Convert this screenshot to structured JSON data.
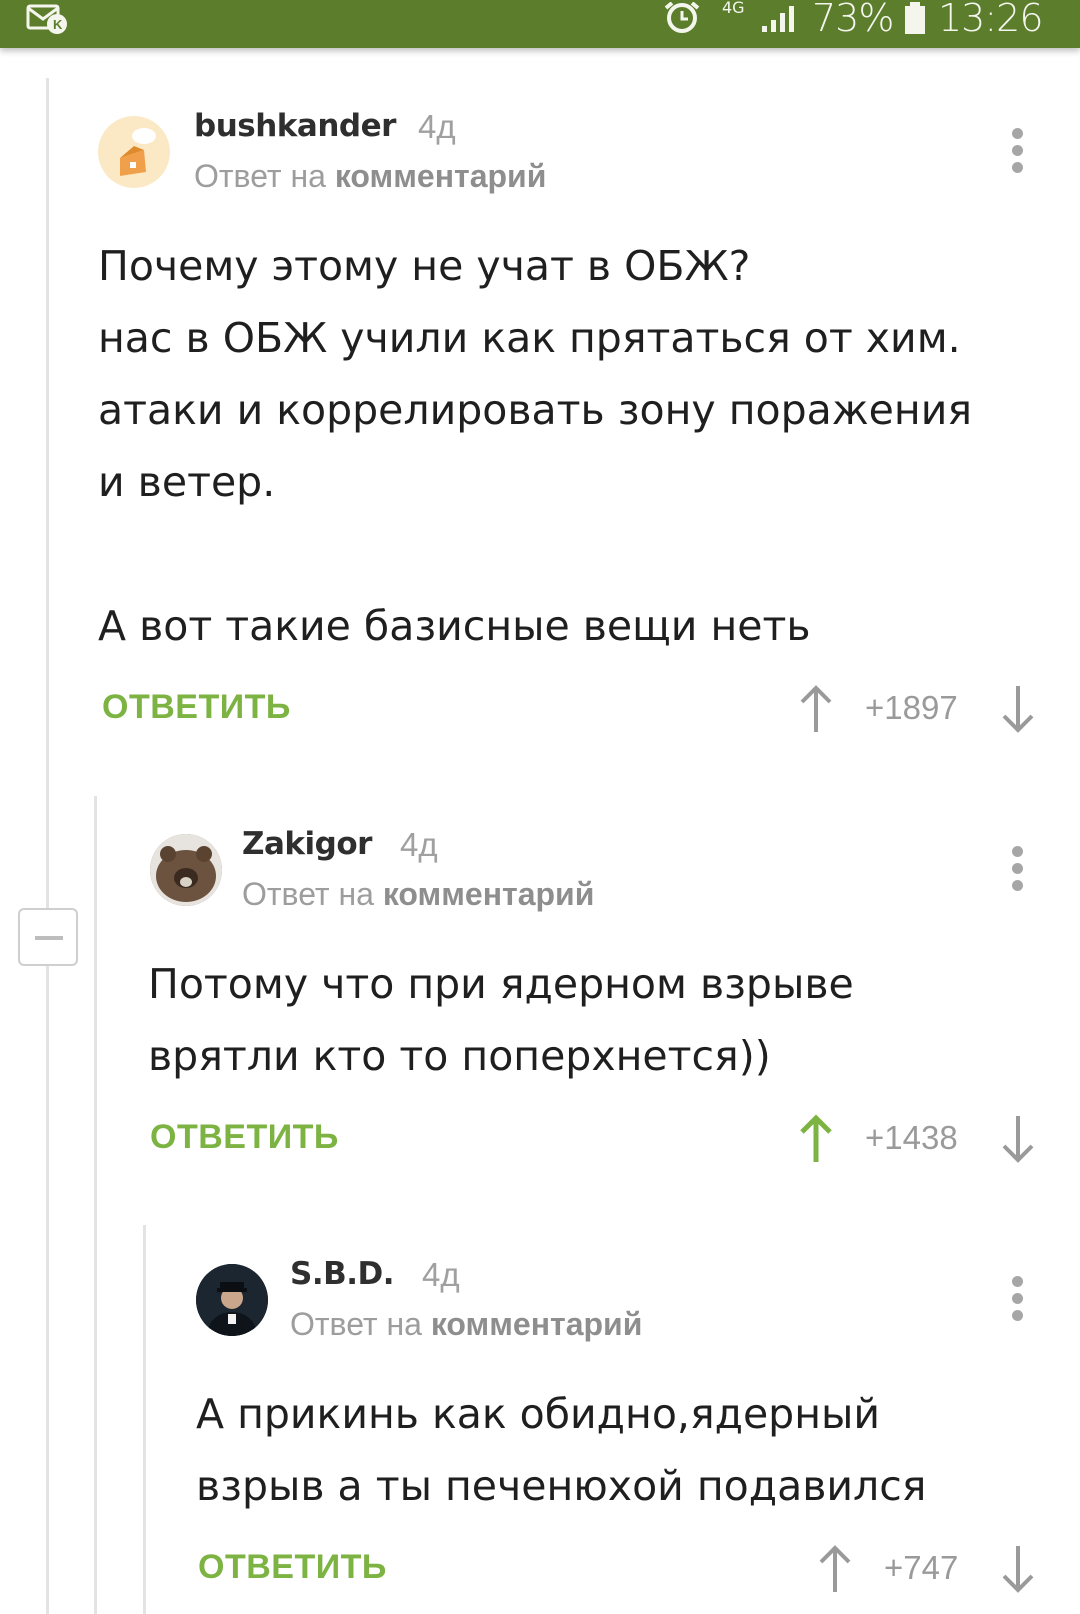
{
  "status_bar": {
    "network": "4G",
    "battery": "73%",
    "time": "13:26",
    "icons": [
      "mail-icon",
      "alarm-icon",
      "signal-icon",
      "battery-icon"
    ],
    "color": "#5b7d2c"
  },
  "colors": {
    "accent_green": "#7cb342",
    "meta_gray": "#a0a0a0",
    "thread_line": "#e3e3e3"
  },
  "comments": [
    {
      "author": "bushkander",
      "age": "4д",
      "reply_prefix": "Ответ на",
      "reply_target": "комментарий",
      "lines": [
        "Почему этому не учат в ОБЖ?",
        "нас в ОБЖ учили как прятаться от хим.",
        "атаки и коррелировать зону поражения",
        "и ветер.",
        "",
        "А вот такие базисные вещи неть"
      ],
      "reply_label": "ОТВЕТИТЬ",
      "rating": "+1897",
      "upvoted": false
    },
    {
      "author": "Zakigor",
      "age": "4д",
      "reply_prefix": "Ответ на",
      "reply_target": "комментарий",
      "lines": [
        "Потому что при ядерном взрыве",
        "врятли кто то поперхнется))"
      ],
      "reply_label": "ОТВЕТИТЬ",
      "rating": "+1438",
      "upvoted": true
    },
    {
      "author": "S.B.D.",
      "age": "4д",
      "reply_prefix": "Ответ на",
      "reply_target": "комментарий",
      "lines": [
        "А прикинь как обидно,ядерный",
        "взрыв а ты печенюхой подавился"
      ],
      "reply_label": "ОТВЕТИТЬ",
      "rating": "+747",
      "upvoted": false
    }
  ]
}
